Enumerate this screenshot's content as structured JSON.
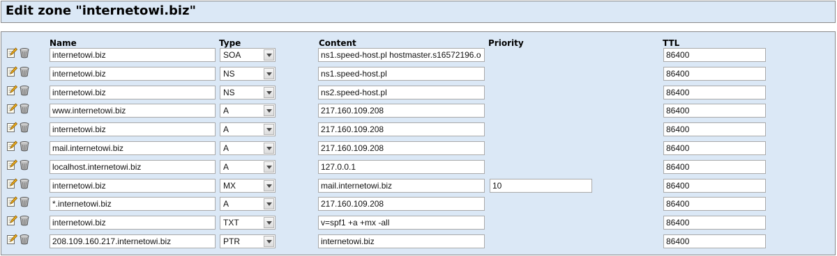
{
  "page": {
    "title": "Edit zone \"internetowi.biz\""
  },
  "columns": {
    "name": "Name",
    "type": "Type",
    "content": "Content",
    "priority": "Priority",
    "ttl": "TTL"
  },
  "icons": {
    "edit": "edit-icon",
    "delete": "delete-trash-icon"
  },
  "records": [
    {
      "name": "internetowi.biz",
      "type": "SOA",
      "content": "ns1.speed-host.pl hostmaster.s16572196.o",
      "priority": null,
      "ttl": "86400"
    },
    {
      "name": "internetowi.biz",
      "type": "NS",
      "content": "ns1.speed-host.pl",
      "priority": null,
      "ttl": "86400"
    },
    {
      "name": "internetowi.biz",
      "type": "NS",
      "content": "ns2.speed-host.pl",
      "priority": null,
      "ttl": "86400"
    },
    {
      "name": "www.internetowi.biz",
      "type": "A",
      "content": "217.160.109.208",
      "priority": null,
      "ttl": "86400"
    },
    {
      "name": "internetowi.biz",
      "type": "A",
      "content": "217.160.109.208",
      "priority": null,
      "ttl": "86400"
    },
    {
      "name": "mail.internetowi.biz",
      "type": "A",
      "content": "217.160.109.208",
      "priority": null,
      "ttl": "86400"
    },
    {
      "name": "localhost.internetowi.biz",
      "type": "A",
      "content": "127.0.0.1",
      "priority": null,
      "ttl": "86400"
    },
    {
      "name": "internetowi.biz",
      "type": "MX",
      "content": "mail.internetowi.biz",
      "priority": "10",
      "ttl": "86400"
    },
    {
      "name": "*.internetowi.biz",
      "type": "A",
      "content": "217.160.109.208",
      "priority": null,
      "ttl": "86400"
    },
    {
      "name": "internetowi.biz",
      "type": "TXT",
      "content": "v=spf1 +a +mx -all",
      "priority": null,
      "ttl": "86400"
    },
    {
      "name": "208.109.160.217.internetowi.biz",
      "type": "PTR",
      "content": "internetowi.biz",
      "priority": null,
      "ttl": "86400"
    }
  ]
}
